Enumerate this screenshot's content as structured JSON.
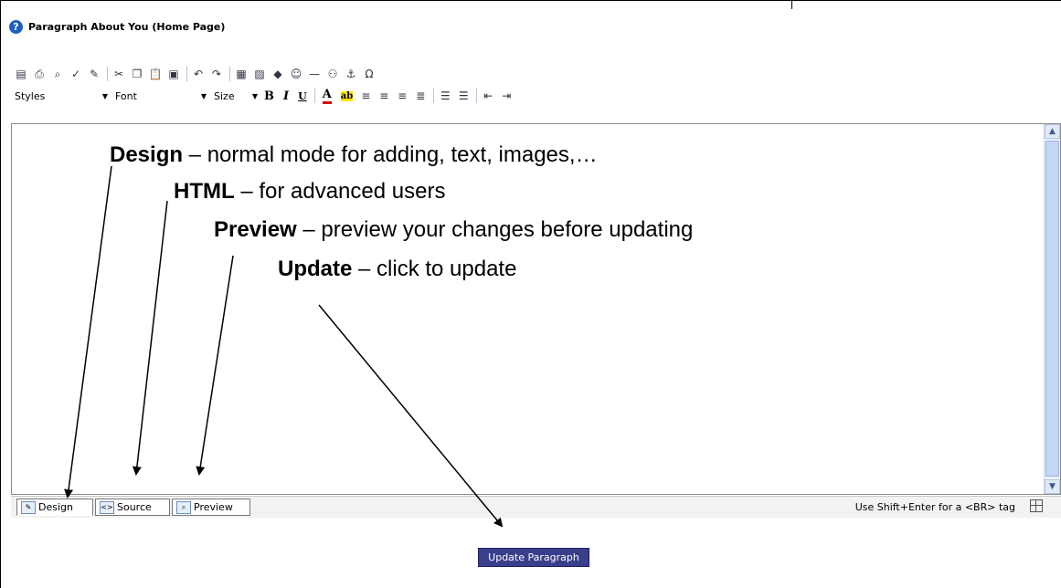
{
  "header": {
    "title": "Paragraph About You (Home Page)"
  },
  "toolbar": {
    "styles_label": "Styles",
    "font_label": "Font",
    "size_label": "Size",
    "bold": "B",
    "italic": "I",
    "underline": "U",
    "font_color": "A",
    "highlight": "ab",
    "special_char": "Ω"
  },
  "tabs": [
    {
      "label": "Design"
    },
    {
      "label": "Source"
    },
    {
      "label": "Preview"
    }
  ],
  "status_hint": "Use Shift+Enter for a <BR> tag",
  "update_button": "Update Paragraph",
  "annotations": [
    {
      "term": "Design",
      "desc": " – normal mode for adding, text, images,…"
    },
    {
      "term": "HTML",
      "desc": " – for advanced users"
    },
    {
      "term": "Preview",
      "desc": " – preview your changes before updating"
    },
    {
      "term": "Update",
      "desc": " – click to update"
    }
  ],
  "colors": {
    "button_bg": "#3a3f8c",
    "help_icon": "#1f5fbf",
    "scrollbar": "#c5d6f3"
  }
}
